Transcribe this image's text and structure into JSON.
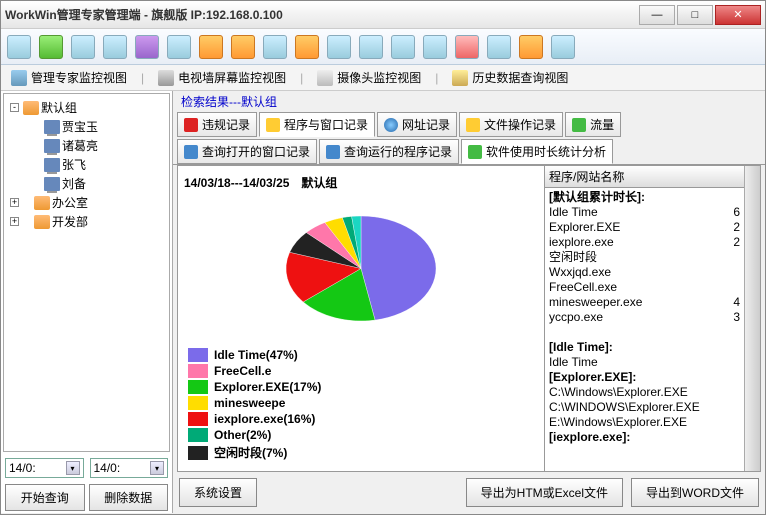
{
  "window": {
    "title": "WorkWin管理专家管理端 - 旗舰版 IP:192.168.0.100"
  },
  "viewtabs": {
    "v0": "管理专家监控视图",
    "v1": "电视墙屏幕监控视图",
    "v2": "摄像头监控视图",
    "v3": "历史数据查询视图"
  },
  "search_result": "检索结果---默认组",
  "tabs": {
    "t0": "违规记录",
    "t1": "程序与窗口记录",
    "t2": "网址记录",
    "t3": "文件操作记录",
    "t4": "流量"
  },
  "subtabs": {
    "s0": "查询打开的窗口记录",
    "s1": "查询运行的程序记录",
    "s2": "软件使用时长统计分析"
  },
  "tree": {
    "root": "默认组",
    "c0": "贾宝玉",
    "c1": "诸葛亮",
    "c2": "张飞",
    "c3": "刘备",
    "g1": "办公室",
    "g2": "开发部"
  },
  "dates": {
    "from": "14/0:",
    "to": "14/0:"
  },
  "actions": {
    "start": "开始查询",
    "del": "删除数据"
  },
  "chart_header": "14/03/18---14/03/25　默认组",
  "list_header": "程序/网站名称",
  "chart_data": {
    "type": "pie",
    "title": "14/03/18---14/03/25 默认组",
    "series": [
      {
        "name": "Idle Time",
        "value": 47,
        "color": "#7b6bea"
      },
      {
        "name": "Explorer.EXE",
        "value": 17,
        "color": "#14c814"
      },
      {
        "name": "iexplore.exe",
        "value": 16,
        "color": "#e11"
      },
      {
        "name": "空闲时段",
        "value": 7,
        "color": "#222"
      },
      {
        "name": "FreeCell.exe",
        "value": 5,
        "color": "#f7a"
      },
      {
        "name": "minesweeper.exe",
        "value": 4,
        "color": "#fd0"
      },
      {
        "name": "Other",
        "value": 2,
        "color": "#0a7"
      },
      {
        "name": "_wedge",
        "value": 2,
        "color": "#1bd6c2"
      }
    ]
  },
  "legend": {
    "l0": "Idle Time(47%)",
    "l1": "Explorer.EXE(17%)",
    "l2": "iexplore.exe(16%)",
    "l3": "空闲时段(7%)",
    "l4": "FreeCell.e",
    "l5": "minesweepe",
    "l6": "Other(2%)"
  },
  "list": {
    "g0": "[默认组累计时长]:",
    "r0": {
      "n": "Idle Time",
      "v": "6"
    },
    "r1": {
      "n": "Explorer.EXE",
      "v": "2"
    },
    "r2": {
      "n": "iexplore.exe",
      "v": "2"
    },
    "r3": {
      "n": "空闲时段",
      "v": ""
    },
    "r4": {
      "n": "Wxxjqd.exe",
      "v": ""
    },
    "r5": {
      "n": "FreeCell.exe",
      "v": ""
    },
    "r6": {
      "n": "minesweeper.exe",
      "v": "4"
    },
    "r7": {
      "n": "yccpo.exe",
      "v": "3"
    },
    "g1": "[Idle Time]:",
    "r8": {
      "n": "Idle Time",
      "v": ""
    },
    "g2": "[Explorer.EXE]:",
    "r9": {
      "n": "C:\\Windows\\Explorer.EXE",
      "v": ""
    },
    "r10": {
      "n": "C:\\WINDOWS\\Explorer.EXE",
      "v": ""
    },
    "r11": {
      "n": "E:\\Windows\\Explorer.EXE",
      "v": ""
    },
    "g3": "[iexplore.exe]:"
  },
  "bottom": {
    "b0": "系统设置",
    "b1": "导出为HTM或Excel文件",
    "b2": "导出到WORD文件"
  }
}
